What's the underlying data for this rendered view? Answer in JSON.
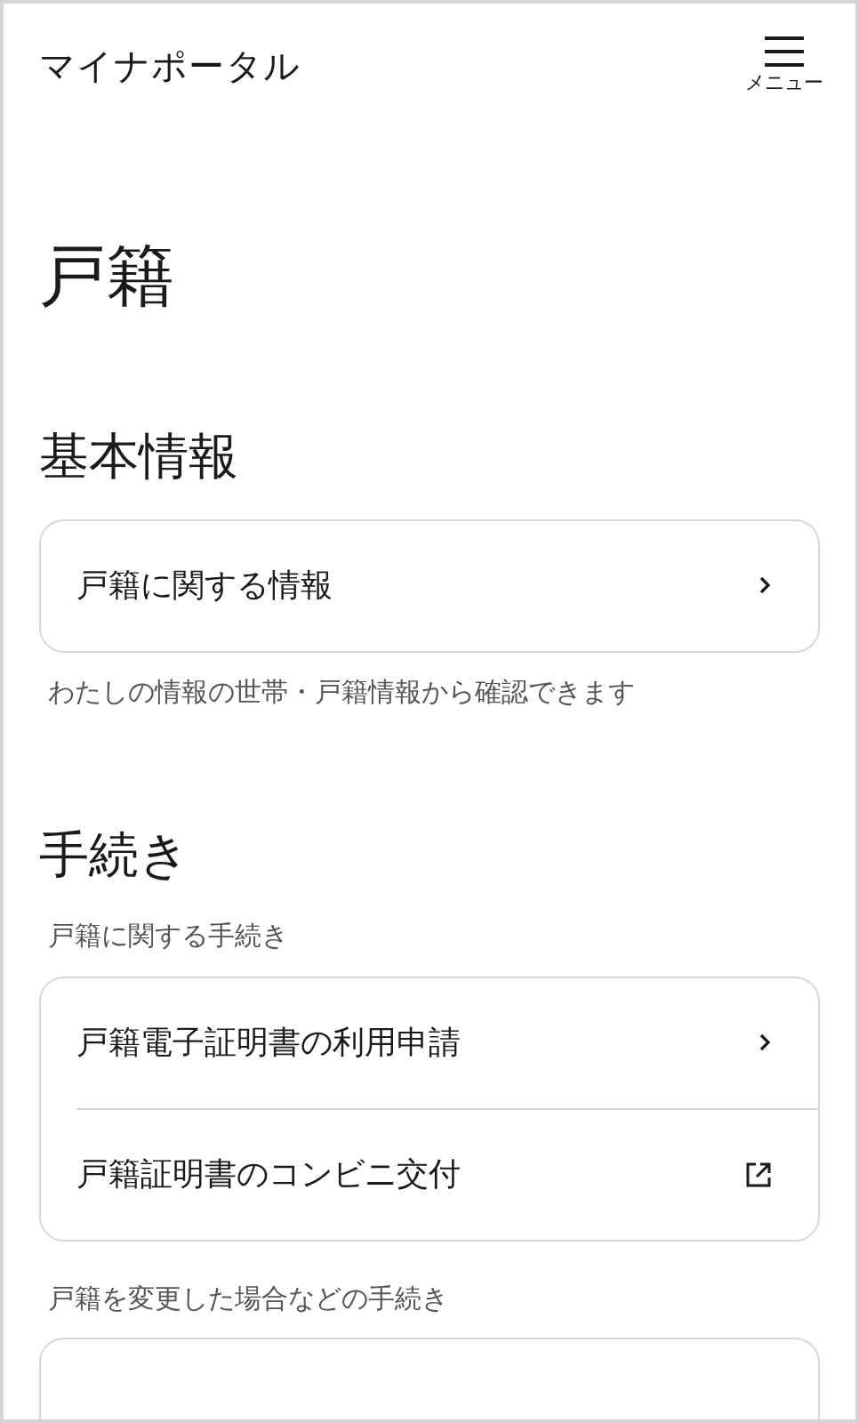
{
  "header": {
    "title": "マイナポータル",
    "menu_label": "メニュー"
  },
  "page_title": "戸籍",
  "sections": [
    {
      "heading": "基本情報",
      "groups": [
        {
          "items": [
            {
              "label": "戸籍に関する情報",
              "kind": "link"
            }
          ],
          "note": "わたしの情報の世帯・戸籍情報から確認できます"
        }
      ]
    },
    {
      "heading": "手続き",
      "groups": [
        {
          "caption": "戸籍に関する手続き",
          "items": [
            {
              "label": "戸籍電子証明書の利用申請",
              "kind": "link"
            },
            {
              "label": "戸籍証明書のコンビニ交付",
              "kind": "external"
            }
          ]
        },
        {
          "caption": "戸籍を変更した場合などの手続き"
        }
      ]
    }
  ]
}
